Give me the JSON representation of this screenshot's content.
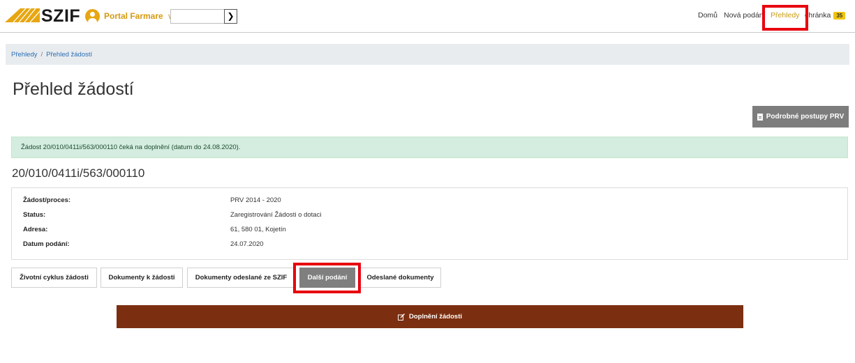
{
  "header": {
    "logo_text": "SZIF",
    "portal_label": "Portal Farmare",
    "search": {
      "value": "",
      "placeholder": ""
    },
    "nav": [
      {
        "label": "Domů"
      },
      {
        "label": "Nová podání"
      },
      {
        "label": "Přehledy"
      },
      {
        "label": "chránka"
      }
    ],
    "inbox_count": "35"
  },
  "breadcrumb": [
    {
      "label": "Přehledy"
    },
    {
      "label": "Přehled žádostí"
    }
  ],
  "page_title": "Přehled žádostí",
  "prv_button_label": "Podrobné postupy PRV",
  "alert_text": "Žádost 20/010/0411i/563/000110 čeká na doplnění (datum do 24.08.2020).",
  "application": {
    "id": "20/010/0411i/563/000110",
    "fields": [
      {
        "label": "Žádost/proces:",
        "value": "PRV 2014 - 2020"
      },
      {
        "label": "Status:",
        "value": "Zaregistrování Žádosti o dotaci"
      },
      {
        "label": "Adresa:",
        "value": "61, 580 01, Kojetín"
      },
      {
        "label": "Datum podání:",
        "value": "24.07.2020"
      }
    ]
  },
  "tabs": [
    {
      "label": "Životní cyklus žádosti"
    },
    {
      "label": "Dokumenty k žádosti"
    },
    {
      "label": "Dokumenty odeslané ze SZIF"
    },
    {
      "label": "Další podání"
    },
    {
      "label": "Odeslané dokumenty"
    }
  ],
  "action_button_label": "Doplnění žádosti",
  "colors": {
    "brand_gold": "#e7a612",
    "action_brown": "#7b2e10",
    "highlight_red": "#e8000e",
    "active_tab_gray": "#7f7f7f"
  }
}
